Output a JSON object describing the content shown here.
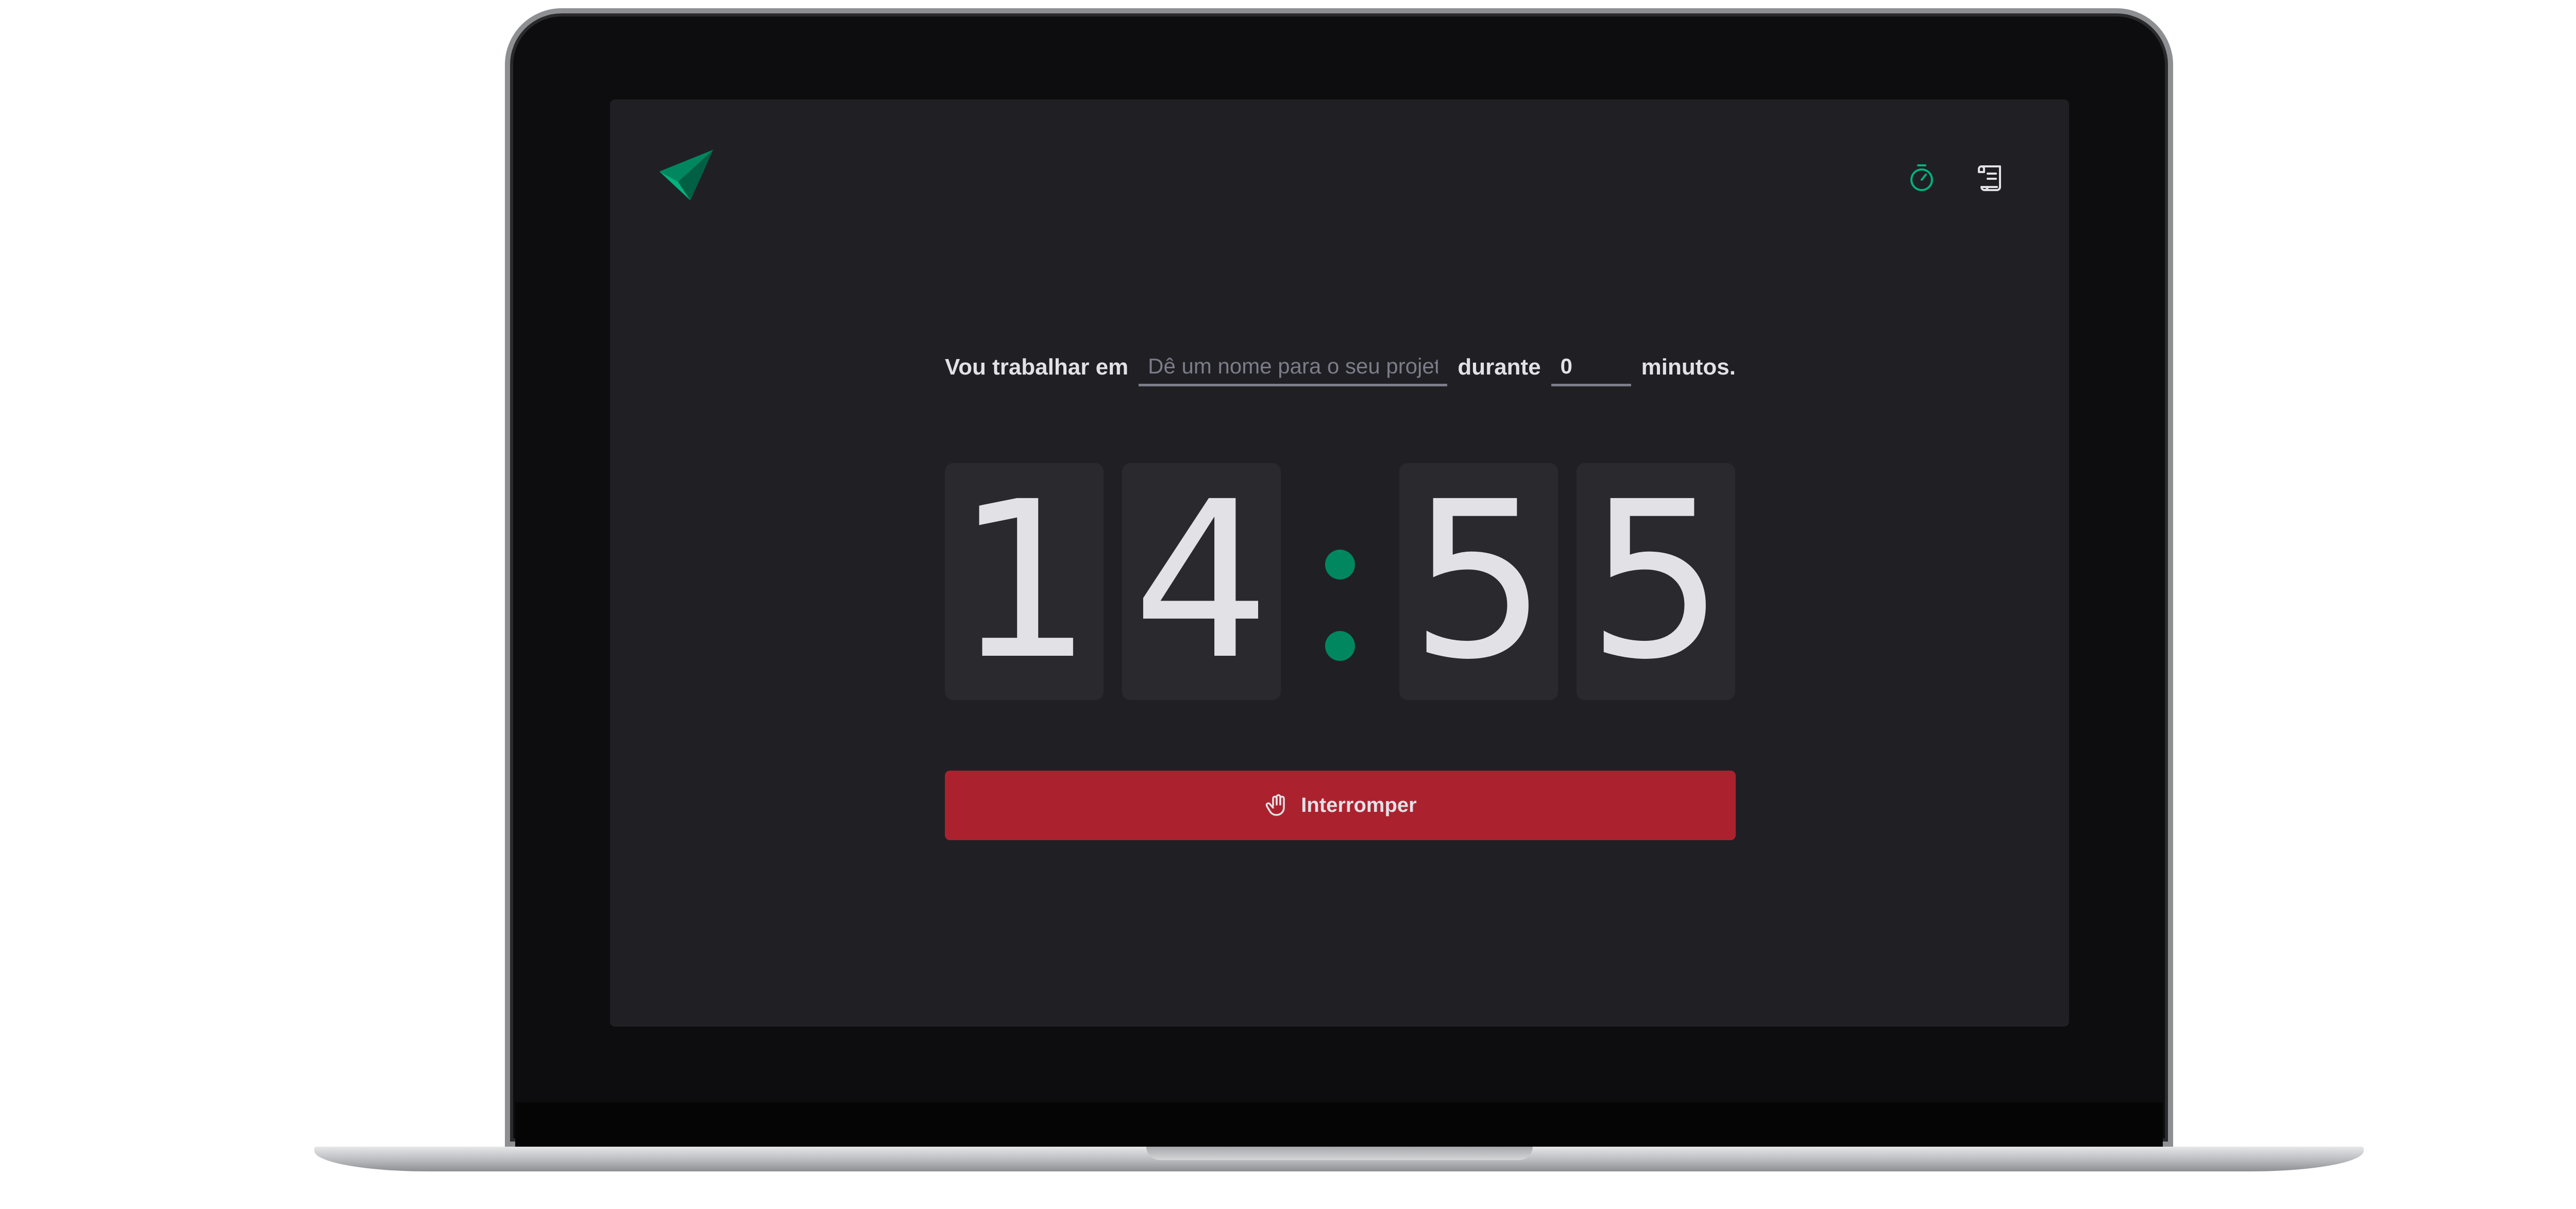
{
  "header": {
    "logo_icon": "ignite-triangle-logo-icon",
    "nav": [
      {
        "icon": "timer-icon",
        "active": true
      },
      {
        "icon": "scroll-icon",
        "active": false
      }
    ]
  },
  "task": {
    "prefix_label": "Vou trabalhar em",
    "project_placeholder": "Dê um nome para o seu projeto",
    "project_value": "",
    "middle_label": "durante",
    "minutes_value": "0",
    "suffix_label": "minutos."
  },
  "countdown": {
    "minutes_tens": "1",
    "minutes_units": "4",
    "seconds_tens": "5",
    "seconds_units": "5"
  },
  "stop_button": {
    "icon": "hand-palm-icon",
    "label": "Interromper"
  },
  "colors": {
    "background": "#202024",
    "accent_green": "#00875f",
    "danger_red": "#ab222e",
    "text": "#e1e1e6",
    "placeholder": "#7c7c8a",
    "digit_box": "#29292e"
  }
}
